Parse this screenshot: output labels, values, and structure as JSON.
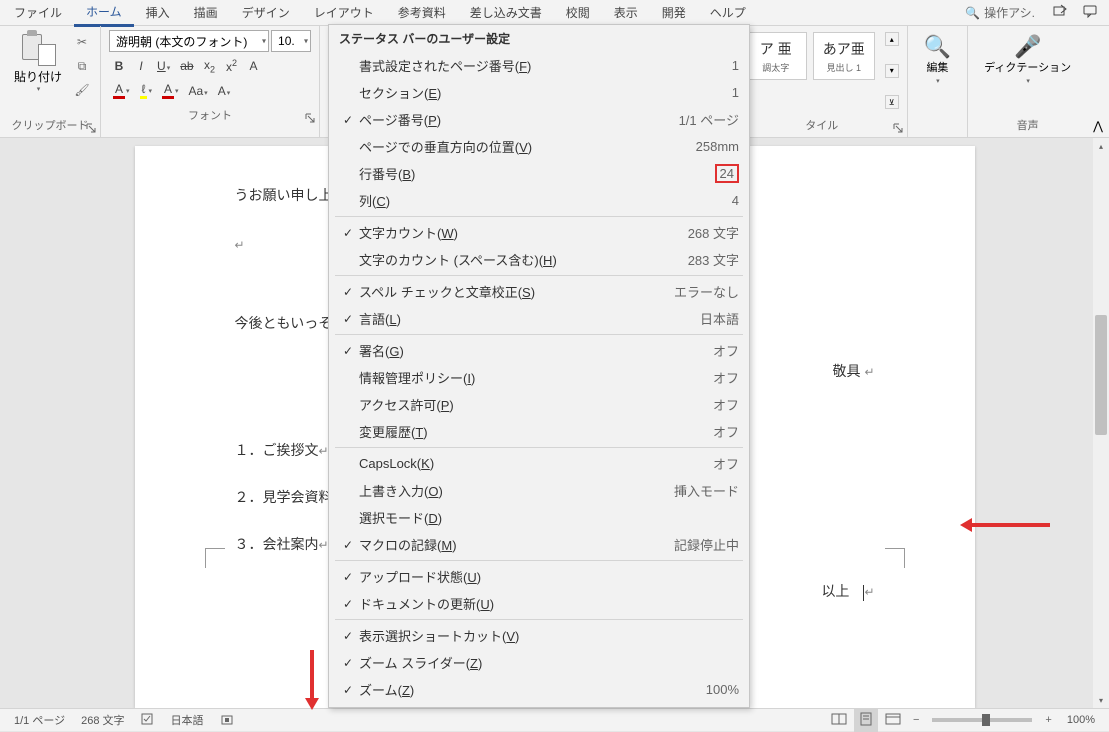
{
  "menubar": {
    "items": [
      "ファイル",
      "ホーム",
      "挿入",
      "描画",
      "デザイン",
      "レイアウト",
      "参考資料",
      "差し込み文書",
      "校閲",
      "表示",
      "開発",
      "ヘルプ"
    ],
    "active_index": 1,
    "search_placeholder": "操作アシ."
  },
  "ribbon": {
    "clipboard": {
      "label": "クリップボード",
      "paste": "貼り付け"
    },
    "font": {
      "label": "フォント",
      "font_name": "游明朝 (本文のフォント)",
      "font_size": "10.",
      "bold": "B",
      "italic": "I",
      "underline": "U",
      "strike": "ab",
      "sub": "x",
      "sup": "x",
      "caseA1": "A",
      "caseA2": "A",
      "highlight": "ℓ",
      "fontcolor": "A",
      "textfx": "Aa"
    },
    "styles": {
      "label": "タイル",
      "items": [
        {
          "preview": "ア 亜",
          "name": "調太字"
        },
        {
          "preview": "あア亜",
          "name": "見出し 1"
        }
      ]
    },
    "editing": {
      "label": "編集"
    },
    "voice": {
      "label": "音声",
      "dictate": "ディクテーション"
    }
  },
  "document": {
    "lines": [
      "うお願い申し上",
      "今後ともいっそ",
      "敬具",
      "１．ご挨拶文",
      "２．見学会資料",
      "３．会社案内",
      "以上"
    ]
  },
  "statusbar": {
    "page": "1/1 ページ",
    "words": "268 文字",
    "language": "日本語",
    "zoom": "100%"
  },
  "context_menu": {
    "title": "ステータス バーのユーザー設定",
    "items": [
      {
        "checked": false,
        "label_pre": "書式設定されたページ番号(",
        "m": "F",
        "label_post": ")",
        "value": "1"
      },
      {
        "checked": false,
        "label_pre": "セクション(",
        "m": "E",
        "label_post": ")",
        "value": "1"
      },
      {
        "checked": true,
        "label_pre": "ページ番号(",
        "m": "P",
        "label_post": ")",
        "value": "1/1 ページ"
      },
      {
        "checked": false,
        "label_pre": "ページでの垂直方向の位置(",
        "m": "V",
        "label_post": ")",
        "value": "258mm"
      },
      {
        "checked": false,
        "label_pre": "行番号(",
        "m": "B",
        "label_post": ")",
        "value": "24",
        "highlighted": true
      },
      {
        "checked": false,
        "label_pre": "列(",
        "m": "C",
        "label_post": ")",
        "value": "4"
      },
      {
        "sep": true
      },
      {
        "checked": true,
        "label_pre": "文字カウント(",
        "m": "W",
        "label_post": ")",
        "value": "268 文字"
      },
      {
        "checked": false,
        "label_pre": "文字のカウント (スペース含む)(",
        "m": "H",
        "label_post": ")",
        "value": "283 文字"
      },
      {
        "sep": true
      },
      {
        "checked": true,
        "label_pre": "スペル チェックと文章校正(",
        "m": "S",
        "label_post": ")",
        "value": "エラーなし"
      },
      {
        "checked": true,
        "label_pre": "言語(",
        "m": "L",
        "label_post": ")",
        "value": "日本語"
      },
      {
        "sep": true
      },
      {
        "checked": true,
        "label_pre": "署名(",
        "m": "G",
        "label_post": ")",
        "value": "オフ"
      },
      {
        "checked": false,
        "label_pre": "情報管理ポリシー(",
        "m": "I",
        "label_post": ")",
        "value": "オフ"
      },
      {
        "checked": false,
        "label_pre": "アクセス許可(",
        "m": "P",
        "label_post": ")",
        "value": "オフ"
      },
      {
        "checked": false,
        "label_pre": "変更履歴(",
        "m": "T",
        "label_post": ")",
        "value": "オフ"
      },
      {
        "sep": true
      },
      {
        "checked": false,
        "label_pre": "CapsLock(",
        "m": "K",
        "label_post": ")",
        "value": "オフ"
      },
      {
        "checked": false,
        "label_pre": "上書き入力(",
        "m": "O",
        "label_post": ")",
        "value": "挿入モード"
      },
      {
        "checked": false,
        "label_pre": "選択モード(",
        "m": "D",
        "label_post": ")",
        "value": ""
      },
      {
        "checked": true,
        "label_pre": "マクロの記録(",
        "m": "M",
        "label_post": ")",
        "value": "記録停止中"
      },
      {
        "sep": true
      },
      {
        "checked": true,
        "label_pre": "アップロード状態(",
        "m": "U",
        "label_post": ")",
        "value": ""
      },
      {
        "checked": true,
        "label_pre": "ドキュメントの更新(",
        "m": "U",
        "label_post": ")",
        "value": ""
      },
      {
        "sep": true
      },
      {
        "checked": true,
        "label_pre": "表示選択ショートカット(",
        "m": "V",
        "label_post": ")",
        "value": ""
      },
      {
        "checked": true,
        "label_pre": "ズーム スライダー(",
        "m": "Z",
        "label_post": ")",
        "value": ""
      },
      {
        "checked": true,
        "label_pre": "ズーム(",
        "m": "Z",
        "label_post": ")",
        "value": "100%"
      }
    ]
  }
}
